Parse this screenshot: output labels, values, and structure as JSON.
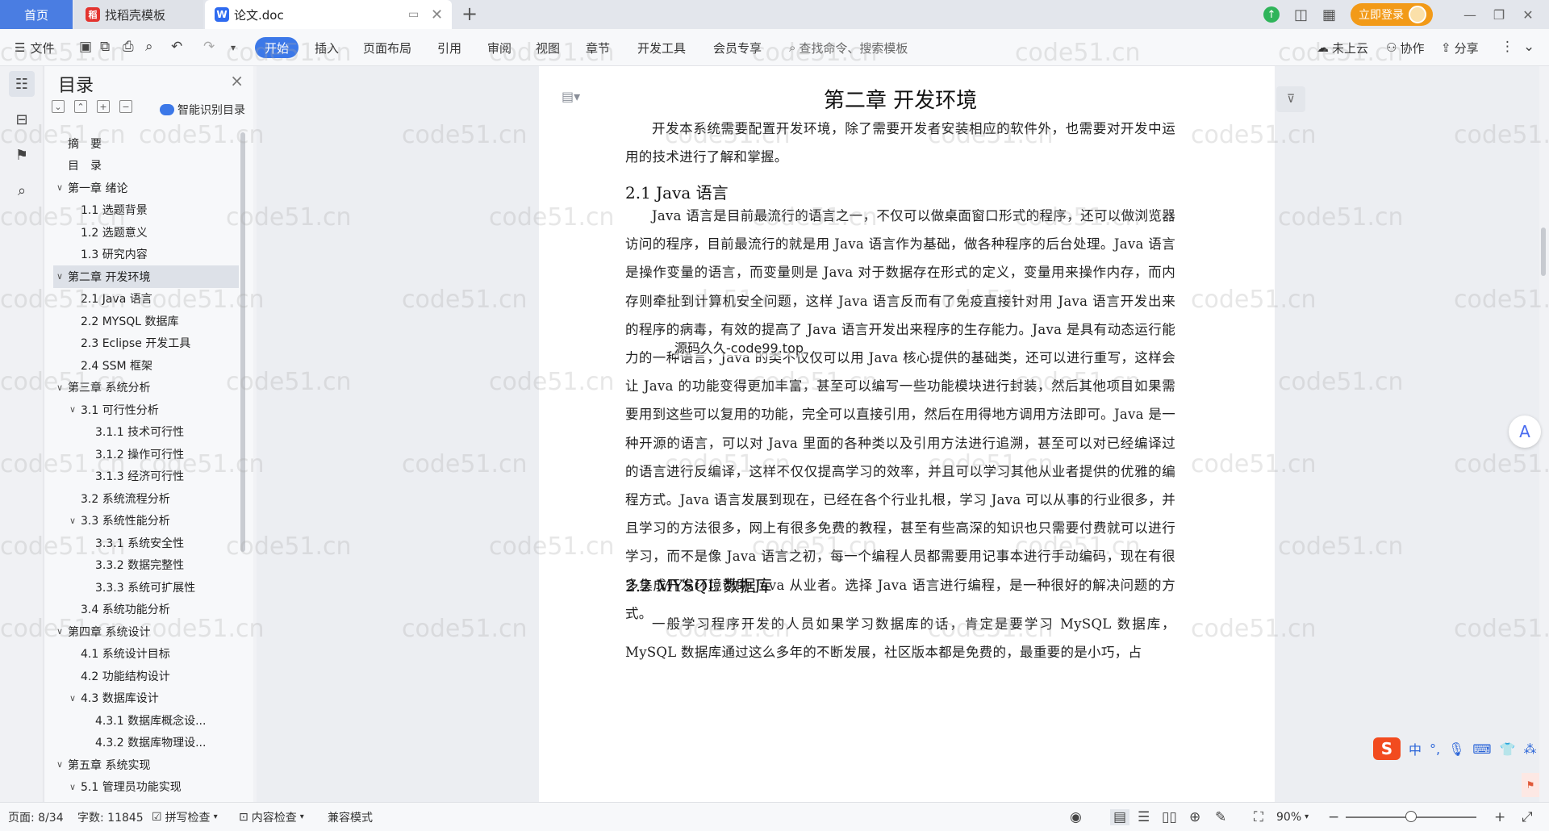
{
  "titlebar": {
    "tabs": [
      {
        "label": "首页"
      },
      {
        "label": "找稻壳模板"
      },
      {
        "label": "论文.doc"
      }
    ],
    "login_label": "立即登录"
  },
  "ribbon": {
    "file_label": "文件",
    "menu": [
      "开始",
      "插入",
      "页面布局",
      "引用",
      "审阅",
      "视图",
      "章节",
      "开发工具",
      "会员专享"
    ],
    "search_placeholder": "查找命令、搜索模板",
    "cloud_label": "未上云",
    "collab_label": "协作",
    "share_label": "分享"
  },
  "toc": {
    "title": "目录",
    "smart_label": "智能识别目录",
    "items": [
      {
        "label": "摘　要",
        "level": 1,
        "expandable": false
      },
      {
        "label": "目　录",
        "level": 1,
        "expandable": false
      },
      {
        "label": "第一章 绪论",
        "level": 1,
        "expandable": true
      },
      {
        "label": "1.1 选题背景",
        "level": 2,
        "expandable": false
      },
      {
        "label": "1.2 选题意义",
        "level": 2,
        "expandable": false
      },
      {
        "label": "1.3 研究内容",
        "level": 2,
        "expandable": false
      },
      {
        "label": "第二章 开发环境",
        "level": 1,
        "expandable": true,
        "selected": true
      },
      {
        "label": "2.1 Java 语言",
        "level": 2,
        "expandable": false
      },
      {
        "label": "2.2 MYSQL 数据库",
        "level": 2,
        "expandable": false
      },
      {
        "label": "2.3 Eclipse 开发工具",
        "level": 2,
        "expandable": false
      },
      {
        "label": "2.4 SSM 框架",
        "level": 2,
        "expandable": false
      },
      {
        "label": "第三章 系统分析",
        "level": 1,
        "expandable": true
      },
      {
        "label": "3.1 可行性分析",
        "level": 2,
        "expandable": true
      },
      {
        "label": "3.1.1 技术可行性",
        "level": 3,
        "expandable": false
      },
      {
        "label": "3.1.2 操作可行性",
        "level": 3,
        "expandable": false
      },
      {
        "label": "3.1.3 经济可行性",
        "level": 3,
        "expandable": false
      },
      {
        "label": "3.2 系统流程分析",
        "level": 2,
        "expandable": false
      },
      {
        "label": "3.3 系统性能分析",
        "level": 2,
        "expandable": true
      },
      {
        "label": "3.3.1 系统安全性",
        "level": 3,
        "expandable": false
      },
      {
        "label": "3.3.2 数据完整性",
        "level": 3,
        "expandable": false
      },
      {
        "label": "3.3.3 系统可扩展性",
        "level": 3,
        "expandable": false
      },
      {
        "label": "3.4 系统功能分析",
        "level": 2,
        "expandable": false
      },
      {
        "label": "第四章 系统设计",
        "level": 1,
        "expandable": true
      },
      {
        "label": "4.1 系统设计目标",
        "level": 2,
        "expandable": false
      },
      {
        "label": "4.2 功能结构设计",
        "level": 2,
        "expandable": false
      },
      {
        "label": "4.3 数据库设计",
        "level": 2,
        "expandable": true
      },
      {
        "label": "4.3.1 数据库概念设...",
        "level": 3,
        "expandable": false
      },
      {
        "label": "4.3.2 数据库物理设...",
        "level": 3,
        "expandable": false
      },
      {
        "label": "第五章 系统实现",
        "level": 1,
        "expandable": true
      },
      {
        "label": "5.1 管理员功能实现",
        "level": 2,
        "expandable": true
      }
    ]
  },
  "document": {
    "chapter_title": "第二章  开发环境",
    "intro": "开发本系统需要配置开发环境，除了需要开发者安装相应的软件外，也需要对开发中运用的技术进行了解和掌握。",
    "sec1_title": "2.1 Java 语言",
    "sec1_body": "Java 语言是目前最流行的语言之一，不仅可以做桌面窗口形式的程序，还可以做浏览器访问的程序，目前最流行的就是用 Java 语言作为基础，做各种程序的后台处理。Java 语言是操作变量的语言，而变量则是 Java 对于数据存在形式的定义，变量用来操作内存，而内存则牵扯到计算机安全问题，这样 Java 语言反而有了免疫直接针对用 Java 语言开发出来的程序的病毒，有效的提高了 Java 语言开发出来程序的生存能力。Java 是具有动态运行能力的一种语言，Java 的类不仅仅可以用 Java 核心提供的基础类，还可以进行重写，这样会让 Java 的功能变得更加丰富，甚至可以编写一些功能模块进行封装，然后其他项目如果需要用到这些可以复用的功能，完全可以直接引用，然后在用得地方调用方法即可。Java 是一种开源的语言，可以对 Java 里面的各种类以及引用方法进行追溯，甚至可以对已经编译过的语言进行反编译，这样不仅仅提高学习的效率，并且可以学习其他从业者提供的优雅的编程方式。Java 语言发展到现在，已经在各个行业扎根，学习 Java 可以从事的行业很多，并且学习的方法很多，网上有很多免费的教程，甚至有些高深的知识也只需要付费就可以进行学习，而不是像 Java 语言之初，每一个编程人员都需要用记事本进行手动编码，现在有很多集成开发环境帮助 Java 从业者。选择 Java 语言进行编程，是一种很好的解决问题的方式。",
    "sec2_title": "2.2 MYSQL 数据库",
    "sec2_body": "一般学习程序开发的人员如果学习数据库的话，肯定是要学习 MySQL 数据库，MySQL 数据库通过这么多年的不断发展，社区版本都是免费的，最重要的是小巧，占",
    "inline_watermark": "源码久久-code99.top",
    "watermark": "code51.cn"
  },
  "ime": {
    "lang": "中"
  },
  "statusbar": {
    "page": "页面: 8/34",
    "words": "字数: 11845",
    "spell": "拼写检查",
    "content_check": "内容检查",
    "compat": "兼容模式",
    "zoom": "90%",
    "zoom_level": 0.5
  }
}
